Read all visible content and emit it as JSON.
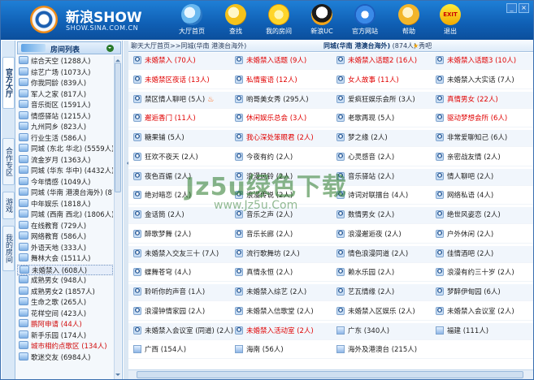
{
  "app": {
    "logo_title": "新浪SHOW",
    "logo_sub": "SHOW.SINA.COM.CN"
  },
  "toolbar": [
    {
      "label": "大厅首页",
      "icon": "lobby-home-icon"
    },
    {
      "label": "查找",
      "icon": "search-icon"
    },
    {
      "label": "我的房间",
      "icon": "star-room-icon"
    },
    {
      "label": "新浪UC",
      "icon": "uc-penguin-icon"
    },
    {
      "label": "官方网站",
      "icon": "ie-browser-icon"
    },
    {
      "label": "帮助",
      "icon": "help-icon"
    },
    {
      "label": "退出",
      "icon": "exit-icon"
    }
  ],
  "exit_badge": "EXIT",
  "window_controls": {
    "minimize": "_",
    "close": "×"
  },
  "sidebar": {
    "tabs": [
      "官方大厅",
      "合作专区",
      "游戏",
      "我的房间"
    ],
    "header": "房间列表",
    "rooms": [
      "综合天空 (1288人)",
      "综艺广场 (1073人)",
      "你我同龄 (839人)",
      "军人之家 (817人)",
      "音乐街区 (1591人)",
      "情感驿站 (1215人)",
      "九州同乡 (823人)",
      "行业生活 (586人)",
      "同城 (东北 华北) (5559人)",
      "流金岁月 (1363人)",
      "同城 (华东 华中) (4432人)",
      "今年情感 (1049人)",
      "同城 (华南 港澳台海外) (874人)",
      "中年娱乐 (1818人)",
      "同城 (西南 西北) (1806人)",
      "在线教育 (729人)",
      "网络教育 (586人)",
      "外语天地 (333人)",
      "舞林大会 (1511人)",
      "未婚禁入 (608人)",
      "成熟男女 (948人)",
      "成熟男女2 (1857人)",
      "生命之歌 (265人)",
      "花样空间 (423人)",
      "鹏阿申请 (44人)",
      "新手乐园 (174人)",
      "城市相约点歌区 (134人)",
      "歌迷交友 (6984人)"
    ]
  },
  "breadcrumb": {
    "path": "聊天大厅首页>>同城(华南 港澳台海外)",
    "current": "同城(华南 港澳台海外)",
    "count": "(874人)",
    "show_label": "秀吧"
  },
  "rooms_grid": [
    [
      "未婚禁入 (70人)",
      "未婚禁入话题 (9人)",
      "未婚禁入话题2 (16人)",
      "未婚禁入话题3 (10人)"
    ],
    [
      "未婚禁区夜话 (13人)",
      "私情蜜语 (12人)",
      "女人故事 (11人)",
      "未婚禁入大实话 (7人)"
    ],
    [
      "禁区情人聊吧 (5人)",
      "哟哥美女秀 (295人)",
      "爱疯狂娱乐会所 (3人)",
      "真情男女 (22人)"
    ],
    [
      "邂逅香门 (11人)",
      "休闲娱乐总会 (3人)",
      "老歌再现 (5人)",
      "驱动梦想会所 (6人)"
    ],
    [
      "糖果铺 (5人)",
      "我心深处笨眼君 (2人)",
      "梦之缘 (2人)",
      "非常爱聊知己 (6人)"
    ],
    [
      "狂欢不夜天 (2人)",
      "今夜有约 (2人)",
      "心灵感音 (2人)",
      "亲密战友情 (2人)"
    ],
    [
      "夜色百媚 (2人)",
      "浪漫风铃 (2人)",
      "音乐驿站 (2人)",
      "情人聊吧 (2人)"
    ],
    [
      "绝对暗恋 (2人)",
      "浪漫传说 (2人)",
      "诗词对联擂台 (4人)",
      "网络私语 (4人)"
    ],
    [
      "金话筒 (2人)",
      "音乐之声 (2人)",
      "数情男女 (2人)",
      "绝世风姿恋 (2人)"
    ],
    [
      "醉歌梦舞 (2人)",
      "音乐长廊 (2人)",
      "浪漫邂逅夜 (2人)",
      "户外休闲 (2人)"
    ],
    [
      "未婚禁入交友三十 (7人)",
      "流行歌舞坊 (2人)",
      "情色浪漫同道 (2人)",
      "佳情酒吧 (2人)"
    ],
    [
      "蝶舞苍穹 (4人)",
      "真情永恒 (2人)",
      "赖水乐园 (2人)",
      "浪漫有约三十岁 (2人)"
    ],
    [
      "聆听你的声音 (1人)",
      "未婚禁入综艺 (2人)",
      "艺瓦情缘 (2人)",
      "梦醉伊甸园 (6人)"
    ],
    [
      "浪漫钟情家园 (2人)",
      "未婚禁入信歌堂 (2人)",
      "未婚禁入区娱乐 (2人)",
      "未婚禁入会议室 (2人)"
    ],
    [
      "未婚禁入会议室 (同道) (2人)",
      "未婚禁入活动室 (2人)",
      "广东 (340人)",
      "福建 (111人)"
    ],
    [
      "广西 (154人)",
      "海南 (56人)",
      "海外及港澳台 (215人)",
      ""
    ]
  ],
  "red_rooms": [
    "0.0",
    "0.1",
    "0.2",
    "0.3",
    "1.0",
    "1.1",
    "1.2",
    "2.3",
    "3.0",
    "3.1",
    "3.3",
    "4.1",
    "14.1"
  ],
  "house_rooms": [
    "14.2",
    "14.3",
    "15.0",
    "15.1",
    "15.2"
  ],
  "watermark": {
    "main": "Jz5u绿色下载",
    "sub": "www.Jz5u.Com"
  }
}
